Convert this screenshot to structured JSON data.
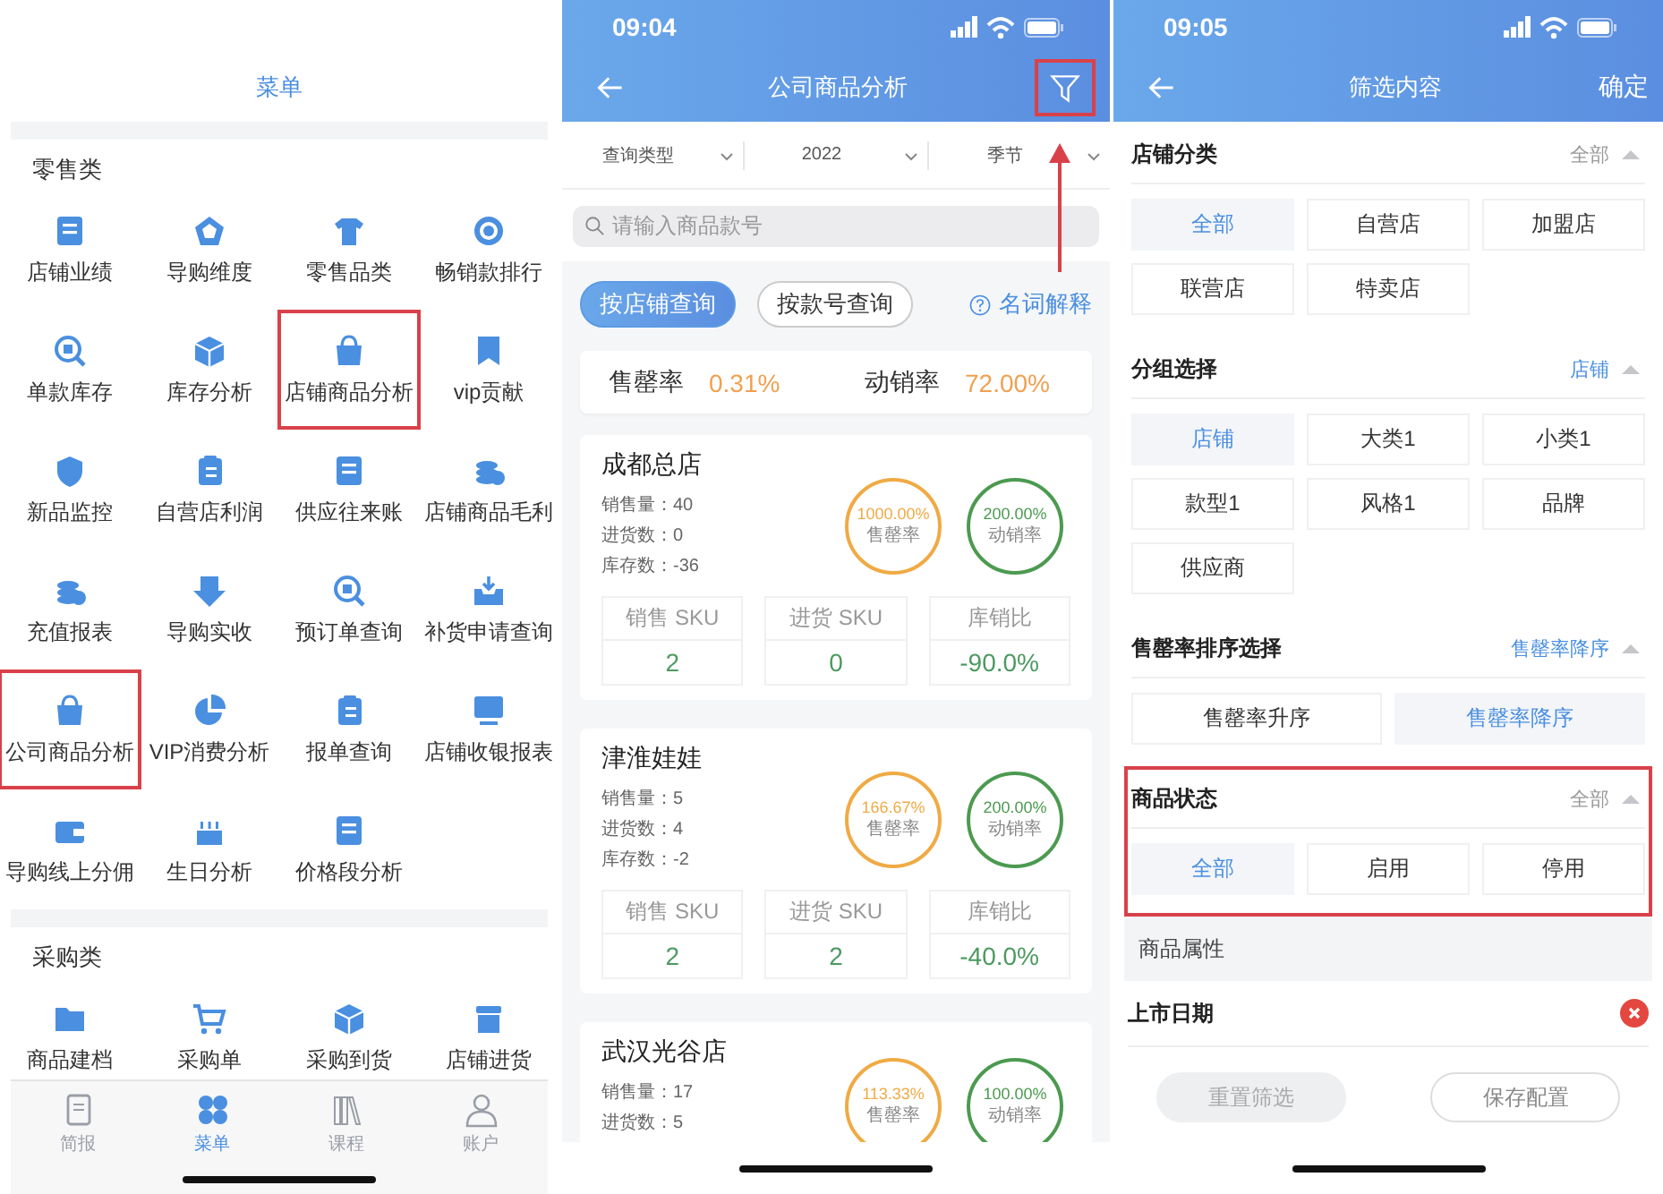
{
  "menu_screen": {
    "title": "菜单",
    "sections": [
      {
        "heading": "零售类",
        "items": [
          {
            "label": "店铺业绩",
            "highlighted": false
          },
          {
            "label": "导购维度",
            "highlighted": false
          },
          {
            "label": "零售品类",
            "highlighted": false
          },
          {
            "label": "畅销款排行",
            "highlighted": false
          },
          {
            "label": "单款库存",
            "highlighted": false
          },
          {
            "label": "库存分析",
            "highlighted": false
          },
          {
            "label": "店铺商品分析",
            "highlighted": true
          },
          {
            "label": "vip贡献",
            "highlighted": false
          },
          {
            "label": "新品监控",
            "highlighted": false
          },
          {
            "label": "自营店利润",
            "highlighted": false
          },
          {
            "label": "供应往来账",
            "highlighted": false
          },
          {
            "label": "店铺商品毛利",
            "highlighted": false
          },
          {
            "label": "充值报表",
            "highlighted": false
          },
          {
            "label": "导购实收",
            "highlighted": false
          },
          {
            "label": "预订单查询",
            "highlighted": false
          },
          {
            "label": "补货申请查询",
            "highlighted": false
          },
          {
            "label": "公司商品分析",
            "highlighted": true
          },
          {
            "label": "VIP消费分析",
            "highlighted": false
          },
          {
            "label": "报单查询",
            "highlighted": false
          },
          {
            "label": "店铺收银报表",
            "highlighted": false
          },
          {
            "label": "导购线上分佣",
            "highlighted": false
          },
          {
            "label": "生日分析",
            "highlighted": false
          },
          {
            "label": "价格段分析",
            "highlighted": false
          }
        ]
      },
      {
        "heading": "采购类",
        "items": [
          {
            "label": "商品建档",
            "highlighted": false
          },
          {
            "label": "采购单",
            "highlighted": false
          },
          {
            "label": "采购到货",
            "highlighted": false
          },
          {
            "label": "店铺进货",
            "highlighted": false
          }
        ]
      }
    ],
    "tab_bar": [
      {
        "label": "简报",
        "selected": false
      },
      {
        "label": "菜单",
        "selected": true
      },
      {
        "label": "课程",
        "selected": false
      },
      {
        "label": "账户",
        "selected": false
      }
    ]
  },
  "analysis_screen": {
    "status_time": "09:04",
    "title": "公司商品分析",
    "filter_highlighted": true,
    "dropdowns": [
      "查询类型",
      "2022",
      "季节"
    ],
    "search": {
      "placeholder": "请输入商品款号"
    },
    "query_tabs": [
      {
        "label": "按店铺查询",
        "selected": true
      },
      {
        "label": "按款号查询",
        "selected": false
      }
    ],
    "help_link": "名词解释",
    "summary": [
      {
        "label": "售罄率",
        "value": "0.31%"
      },
      {
        "label": "动销率",
        "value": "72.00%"
      }
    ],
    "stores": [
      {
        "name": "成都总店",
        "stats": [
          "销售量：40",
          "进货数：0",
          "库存数：-36"
        ],
        "rings": [
          {
            "value": "1000.00%",
            "label": "售罄率",
            "color": "#f0aa44"
          },
          {
            "value": "200.00%",
            "label": "动销率",
            "color": "#4c9a50"
          }
        ],
        "metrics": [
          {
            "label": "销售 SKU",
            "value": "2"
          },
          {
            "label": "进货 SKU",
            "value": "0"
          },
          {
            "label": "库销比",
            "value": "-90.0%"
          }
        ]
      },
      {
        "name": "津淮娃娃",
        "stats": [
          "销售量：5",
          "进货数：4",
          "库存数：-2"
        ],
        "rings": [
          {
            "value": "166.67%",
            "label": "售罄率",
            "color": "#f0aa44"
          },
          {
            "value": "200.00%",
            "label": "动销率",
            "color": "#4c9a50"
          }
        ],
        "metrics": [
          {
            "label": "销售 SKU",
            "value": "2"
          },
          {
            "label": "进货 SKU",
            "value": "2"
          },
          {
            "label": "库销比",
            "value": "-40.0%"
          }
        ]
      },
      {
        "name": "武汉光谷店",
        "stats": [
          "销售量：17",
          "进货数：5"
        ],
        "rings": [
          {
            "value": "113.33%",
            "label": "售罄率",
            "color": "#f0aa44"
          },
          {
            "value": "100.00%",
            "label": "动销率",
            "color": "#4c9a50"
          }
        ]
      }
    ]
  },
  "filter_screen": {
    "status_time": "09:05",
    "title": "筛选内容",
    "confirm": "确定",
    "sections": [
      {
        "title": "店铺分类",
        "current": "全部",
        "current_active": false,
        "kind": "grid",
        "highlighted": false,
        "options": [
          {
            "label": "全部",
            "selected": true
          },
          {
            "label": "自营店",
            "selected": false
          },
          {
            "label": "加盟店",
            "selected": false
          },
          {
            "label": "联营店",
            "selected": false
          },
          {
            "label": "特卖店",
            "selected": false
          }
        ]
      },
      {
        "title": "分组选择",
        "current": "店铺",
        "current_active": true,
        "kind": "grid",
        "highlighted": false,
        "options": [
          {
            "label": "店铺",
            "selected": true
          },
          {
            "label": "大类1",
            "selected": false
          },
          {
            "label": "小类1",
            "selected": false
          },
          {
            "label": "款型1",
            "selected": false
          },
          {
            "label": "风格1",
            "selected": false
          },
          {
            "label": "品牌",
            "selected": false
          },
          {
            "label": "供应商",
            "selected": false
          }
        ]
      },
      {
        "title": "售罄率排序选择",
        "current": "售罄率降序",
        "current_active": true,
        "kind": "pair",
        "highlighted": false,
        "options": [
          {
            "label": "售罄率升序",
            "selected": false
          },
          {
            "label": "售罄率降序",
            "selected": true
          }
        ]
      },
      {
        "title": "商品状态",
        "current": "全部",
        "current_active": false,
        "kind": "grid",
        "highlighted": true,
        "options": [
          {
            "label": "全部",
            "selected": true
          },
          {
            "label": "启用",
            "selected": false
          },
          {
            "label": "停用",
            "selected": false
          }
        ]
      }
    ],
    "group_header": "商品属性",
    "attribute_rows": [
      {
        "label": "上市日期"
      }
    ],
    "buttons": [
      {
        "label": "重置筛选",
        "disabled": true
      },
      {
        "label": "保存配置",
        "disabled": false
      }
    ]
  }
}
